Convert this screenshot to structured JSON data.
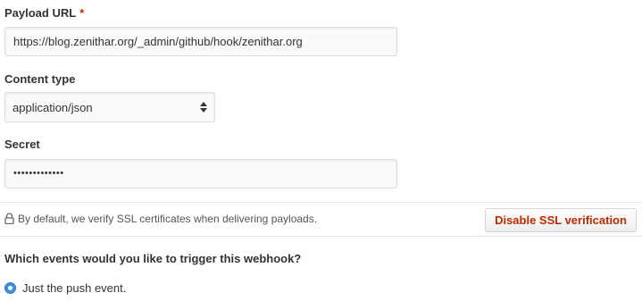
{
  "payload_url": {
    "label": "Payload URL",
    "required_mark": "*",
    "value": "https://blog.zenithar.org/_admin/github/hook/zenithar.org"
  },
  "content_type": {
    "label": "Content type",
    "selected": "application/json"
  },
  "secret": {
    "label": "Secret",
    "masked_value": "•••••••••••••"
  },
  "ssl": {
    "note": "By default, we verify SSL certificates when delivering payloads.",
    "button_label": "Disable SSL verification",
    "icon": "lock-icon"
  },
  "events": {
    "question": "Which events would you like to trigger this webhook?",
    "option_label": "Just the push event.",
    "option_selected": true
  },
  "colors": {
    "accent_red": "#bd2c00",
    "radio_blue": "#3d8fe0"
  }
}
